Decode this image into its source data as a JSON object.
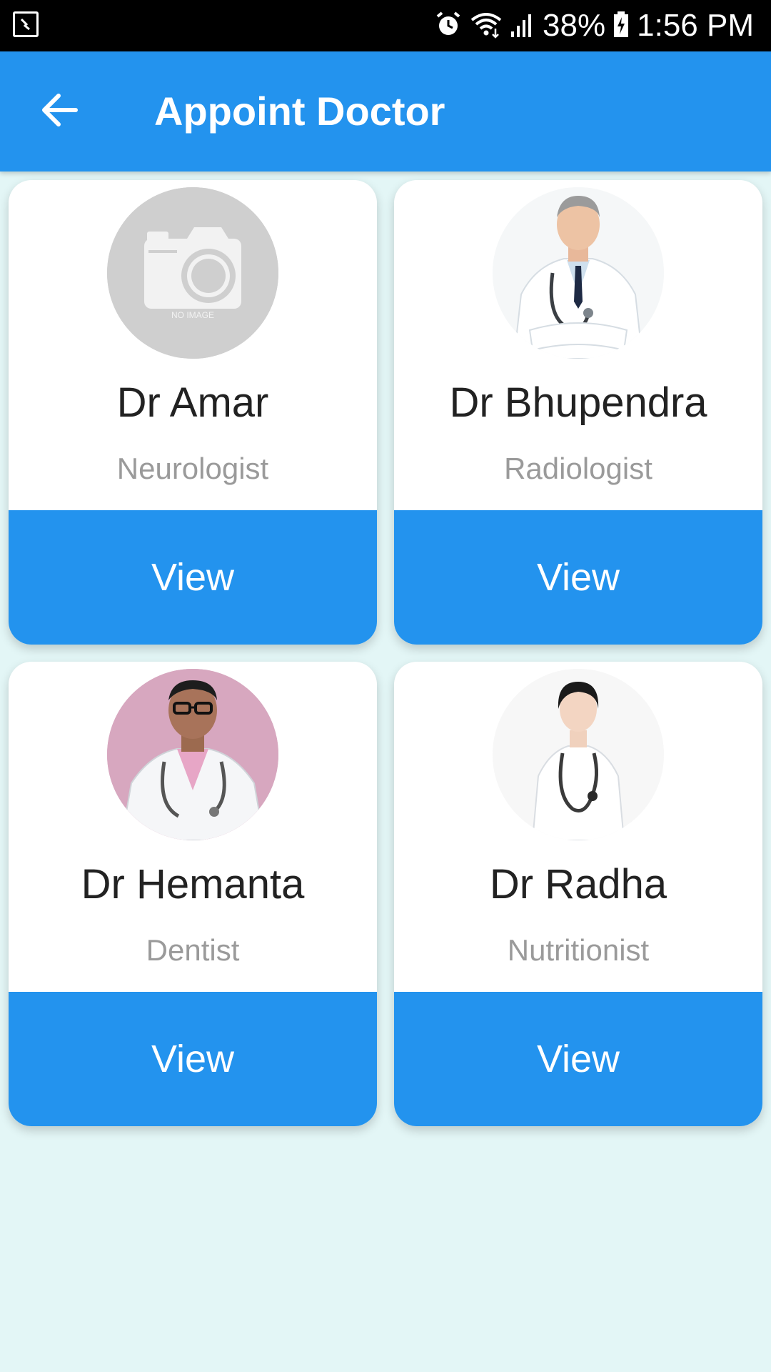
{
  "status_bar": {
    "battery": "38%",
    "time": "1:56 PM",
    "icons": [
      "screenshot-icon",
      "alarm-icon",
      "wifi-icon",
      "signal-icon",
      "battery-charging-icon"
    ]
  },
  "app_bar": {
    "title": "Appoint Doctor",
    "back_icon": "arrow-back-icon"
  },
  "colors": {
    "primary": "#2393ee",
    "background": "#e3f6f6",
    "card": "#ffffff",
    "name_text": "#222222",
    "specialty_text": "#9a9a9a"
  },
  "doctors": [
    {
      "name": "Dr Amar",
      "specialty": "Neurologist",
      "button": "View",
      "avatar": "no-image-placeholder",
      "avatar_text": "NO IMAGE"
    },
    {
      "name": "Dr Bhupendra",
      "specialty": "Radiologist",
      "button": "View",
      "avatar": "doctor-photo"
    },
    {
      "name": "Dr Hemanta",
      "specialty": "Dentist",
      "button": "View",
      "avatar": "doctor-photo"
    },
    {
      "name": "Dr Radha",
      "specialty": "Nutritionist",
      "button": "View",
      "avatar": "doctor-photo"
    }
  ]
}
